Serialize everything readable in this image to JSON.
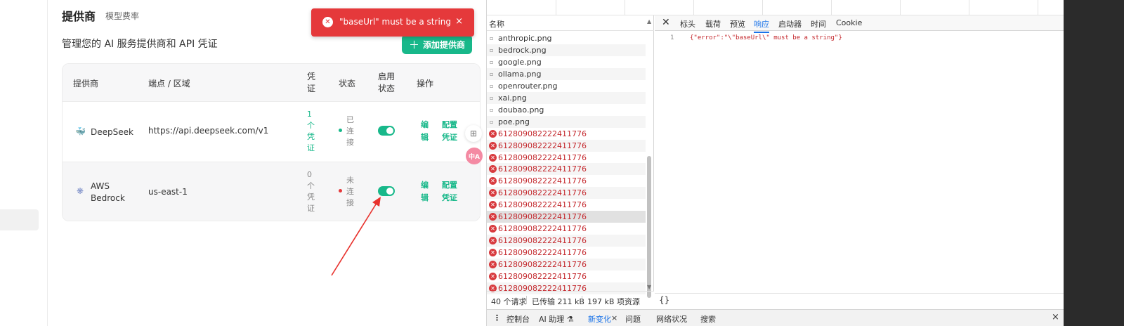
{
  "header": {
    "title": "提供商",
    "subtab": "模型费率"
  },
  "description": "管理您的 AI 服务提供商和 API 凭证",
  "add_button": {
    "icon": "plus-icon",
    "label": "添加提供商"
  },
  "table": {
    "headers": {
      "provider": "提供商",
      "endpoint": "端点 / 区域",
      "credentials": "凭证",
      "status": "状态",
      "enabled": "启用状态",
      "actions": "操作"
    },
    "rows": [
      {
        "provider": "DeepSeek",
        "icon": "deepseek-whale-icon",
        "endpoint": "https://api.deepseek.com/v1",
        "credentials": "1个凭证",
        "status": "已连接",
        "status_color": "#18b88a",
        "enabled": true,
        "edit": "编辑",
        "config": "配置凭证"
      },
      {
        "provider": "AWS Bedrock",
        "icon": "bedrock-icon",
        "endpoint": "us-east-1",
        "credentials": "0个凭证",
        "status": "未连接",
        "status_color": "#e5393b",
        "enabled": true,
        "edit": "编辑",
        "config": "配置凭证"
      }
    ]
  },
  "toast": {
    "icon": "error-icon",
    "message": "\"baseUrl\" must be a string",
    "close": "×"
  },
  "devtools": {
    "list_header": "名称",
    "requests": [
      {
        "name": "anthropic.png",
        "error": false
      },
      {
        "name": "bedrock.png",
        "error": false
      },
      {
        "name": "google.png",
        "error": false
      },
      {
        "name": "ollama.png",
        "error": false
      },
      {
        "name": "openrouter.png",
        "error": false
      },
      {
        "name": "xai.png",
        "error": false
      },
      {
        "name": "doubao.png",
        "error": false
      },
      {
        "name": "poe.png",
        "error": false
      },
      {
        "name": "612809082222411776",
        "error": true
      },
      {
        "name": "612809082222411776",
        "error": true
      },
      {
        "name": "612809082222411776",
        "error": true
      },
      {
        "name": "612809082222411776",
        "error": true
      },
      {
        "name": "612809082222411776",
        "error": true
      },
      {
        "name": "612809082222411776",
        "error": true
      },
      {
        "name": "612809082222411776",
        "error": true
      },
      {
        "name": "612809082222411776",
        "error": true,
        "selected": true
      },
      {
        "name": "612809082222411776",
        "error": true
      },
      {
        "name": "612809082222411776",
        "error": true
      },
      {
        "name": "612809082222411776",
        "error": true
      },
      {
        "name": "612809082222411776",
        "error": true
      },
      {
        "name": "612809082222411776",
        "error": true
      },
      {
        "name": "612809082222411776",
        "error": true
      }
    ],
    "detail_tabs": [
      "标头",
      "载荷",
      "预览",
      "响应",
      "启动器",
      "时间",
      "Cookie"
    ],
    "active_tab": "响应",
    "response": {
      "line": "1",
      "body": "{\"error\":\"\\\"baseUrl\\\" must be a string\"}"
    },
    "pretty_print": "{}",
    "status": {
      "requests": "40 个请求",
      "transferred": "已传输 211 kB",
      "resources": "197 kB 项资源"
    },
    "drawer_tabs": [
      "控制台",
      "AI 助理 ⚗",
      "新变化",
      "问题",
      "网络状况",
      "搜索"
    ],
    "drawer_active": "新变化",
    "drawer_close": "×"
  }
}
